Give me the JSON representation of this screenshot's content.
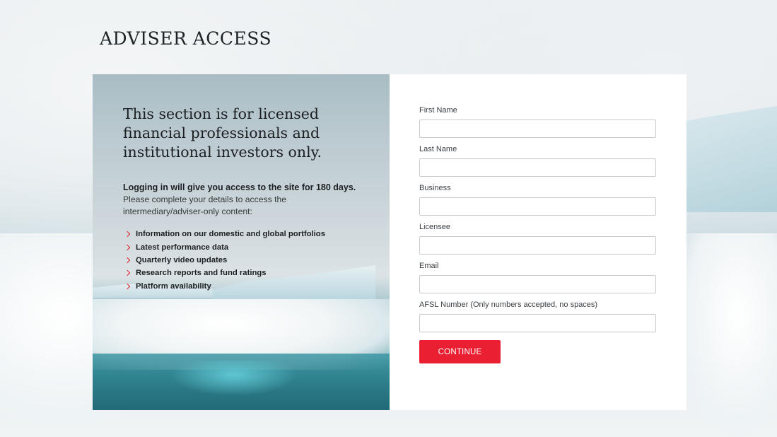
{
  "page": {
    "title": "ADVISER ACCESS"
  },
  "promo": {
    "heading": "This section is for licensed financial professionals and institutional investors only.",
    "lead": "Logging in will give you access to the site for 180 days.",
    "text": "Please complete your details to access the intermediary/adviser-only content:",
    "bullet_icon": "chevron-right-icon",
    "bullet_color": "#e3222f",
    "items": [
      "Information on our domestic and global portfolios",
      "Latest performance data",
      "Quarterly video updates",
      "Research reports and fund ratings",
      "Platform availability"
    ]
  },
  "form": {
    "fields": [
      {
        "label": "First Name",
        "value": ""
      },
      {
        "label": "Last Name",
        "value": ""
      },
      {
        "label": "Business",
        "value": ""
      },
      {
        "label": "Licensee",
        "value": ""
      },
      {
        "label": "Email",
        "value": ""
      },
      {
        "label": "AFSL Number (Only numbers accepted, no spaces)",
        "value": ""
      }
    ],
    "submit_label": "CONTINUE",
    "submit_color": "#ea1f31"
  }
}
